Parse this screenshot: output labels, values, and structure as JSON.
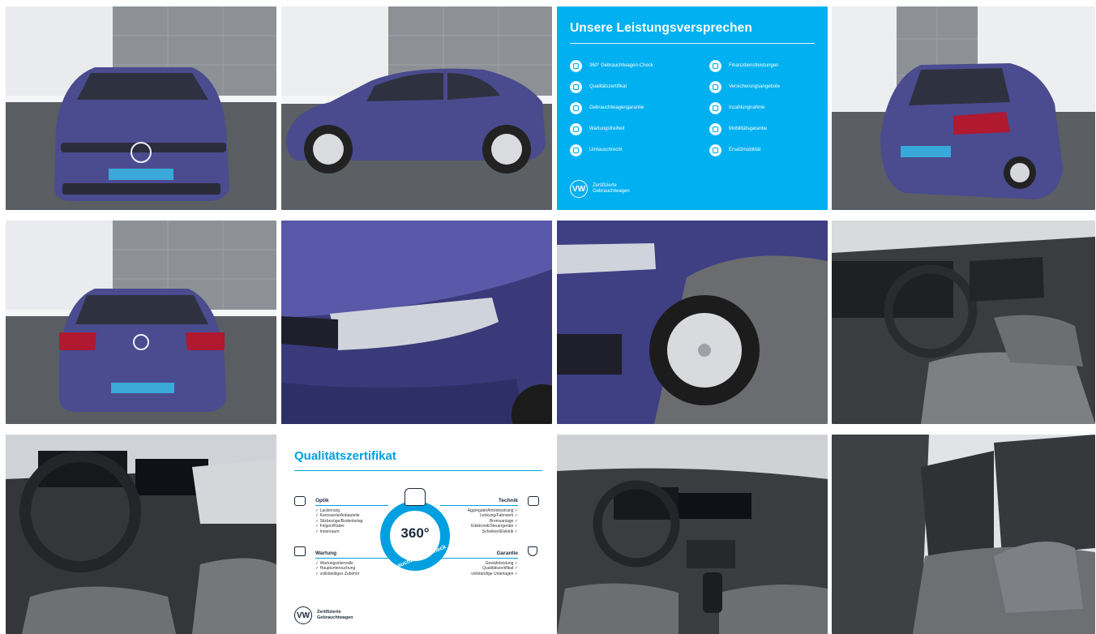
{
  "gallery": {
    "tiles": [
      {
        "photo": "front-view"
      },
      {
        "photo": "side-view"
      },
      {
        "photo": "promise-graphic"
      },
      {
        "photo": "rear-three-quarter-view"
      },
      {
        "photo": "rear-view"
      },
      {
        "photo": "hood-headlight-closeup"
      },
      {
        "photo": "front-wheel-closeup"
      },
      {
        "photo": "driver-interior"
      },
      {
        "photo": "cockpit-detail"
      },
      {
        "photo": "quality-certificate-graphic"
      },
      {
        "photo": "dashboard-center"
      },
      {
        "photo": "rear-seats"
      }
    ]
  },
  "promise": {
    "title": "Unsere Leistungsversprechen",
    "items_left": [
      "360° Gebrauchtwagen-Check",
      "Qualitätszertifikat",
      "Gebrauchtwagengarantie",
      "Wartungsfreiheit",
      "Umtauschrecht"
    ],
    "items_right": [
      "Finanzdienstleistungen",
      "Versicherungsangebote",
      "Inzahlungnahme",
      "Mobilitätsgarantie",
      "Ersatzmobilität"
    ],
    "footer": "Zertifizierte\nGebrauchtwagen",
    "logo": "VW",
    "accent": "#00b0f0"
  },
  "quality": {
    "title": "Qualitätszertifikat",
    "ring_value": "360°",
    "ring_label": "Gebrauchtwagen-Check",
    "optik": {
      "heading": "Optik",
      "items": [
        "✓ Lackierung",
        "✓ Karosserie/Anbauteile",
        "✓ Sitzbezüge/Bodenbelag",
        "✓ Felgen/Räder",
        "✓ Innenraum"
      ]
    },
    "technik": {
      "heading": "Technik",
      "items": [
        "Aggregate/Antriebsstrang ✓",
        "Lenkung/Fahrwerk ✓",
        "Bremsanlage ✓",
        "Elektronik/Steuergeräte ✓",
        "Scheiben/Elektrik ✓"
      ]
    },
    "wartung": {
      "heading": "Wartung",
      "items": [
        "✓ Wartungsintervalle",
        "✓ Hauptuntersuchung",
        "✓ vollständiges Zubehör"
      ]
    },
    "garantie": {
      "heading": "Garantie",
      "items": [
        "Gewährleistung ✓",
        "Qualitätszertifikat ✓",
        "vollständige Unterlagen ✓"
      ]
    },
    "footer": "Zertifizierte\nGebrauchtwagen",
    "logo": "VW",
    "accent": "#00a0e0"
  },
  "colors": {
    "car_body": "#4a4a8e",
    "car_body_dark": "#343470",
    "wall_gray": "#8a8e93",
    "floor": "#55585c",
    "interior": "#3c3e42"
  }
}
